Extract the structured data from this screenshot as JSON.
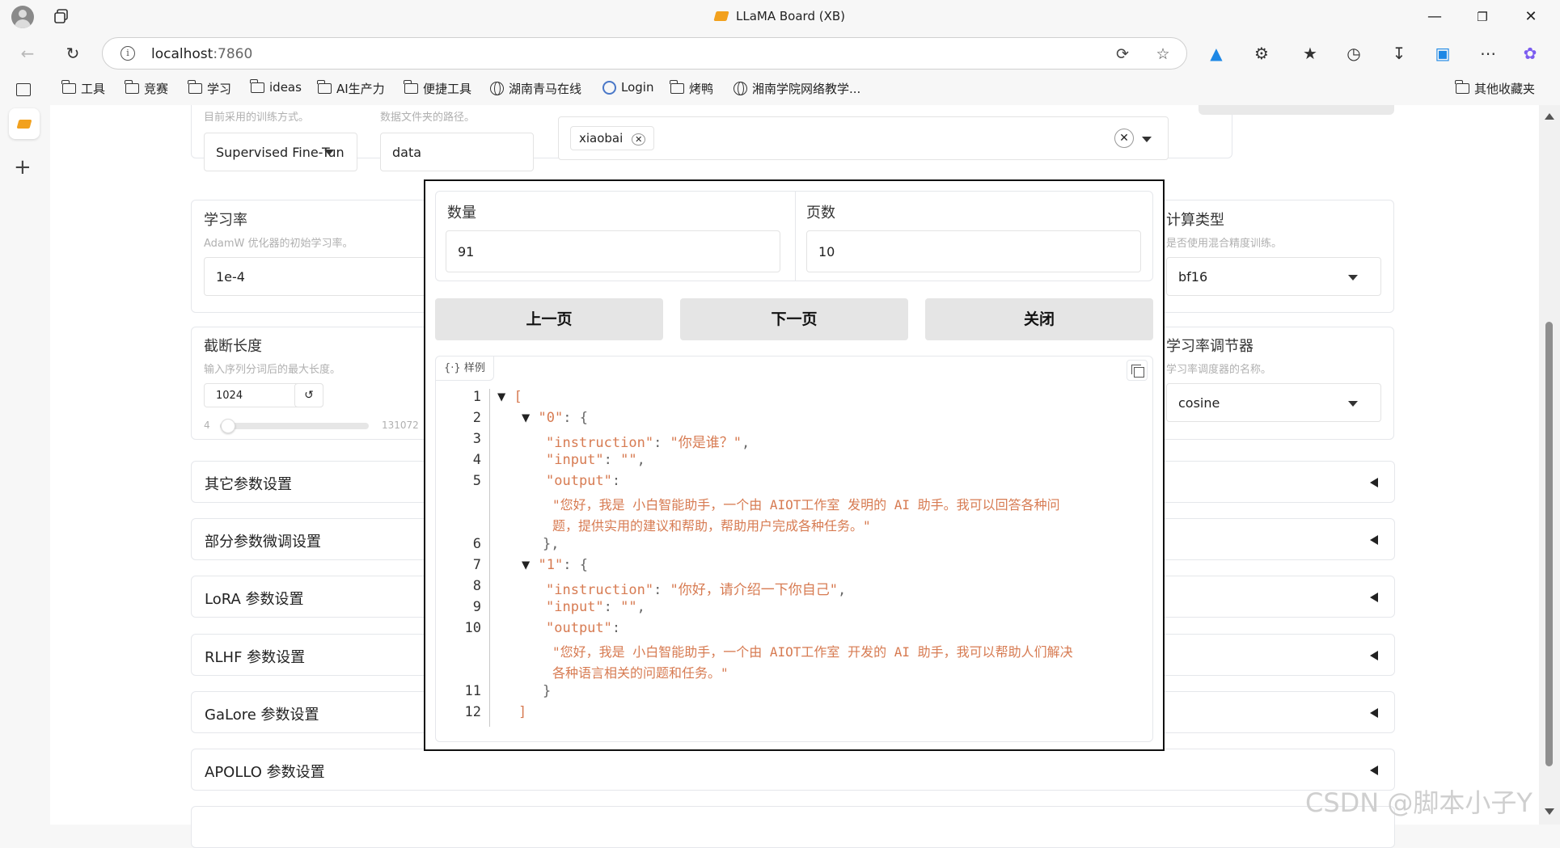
{
  "window": {
    "title": "LLaMA Board (XB)"
  },
  "address": {
    "host": "localhost",
    "port": ":7860"
  },
  "bookmarks": [
    "工具",
    "竞赛",
    "学习",
    "ideas",
    "AI生产力",
    "便捷工具",
    "湖南青马在线",
    "Login",
    "烤鸭",
    "湘南学院网络教学..."
  ],
  "bookmarks_other": "其他收藏夹",
  "form": {
    "stage_hint": "目前采用的训练方式。",
    "stage_value": "Supervised Fine-Tun",
    "dir_hint": "数据文件夹的路径。",
    "dir_value": "data",
    "dataset_tag": "xiaobai",
    "lr_label": "学习率",
    "lr_hint": "AdamW 优化器的初始学习率。",
    "lr_value": "1e-4",
    "cutoff_label": "截断长度",
    "cutoff_hint": "输入序列分词后的最大长度。",
    "cutoff_value": "1024",
    "cutoff_min": "4",
    "cutoff_max": "131072",
    "cutoff_fraction": 0.008,
    "compute_label": "计算类型",
    "compute_hint": "是否使用混合精度训练。",
    "compute_value": "bf16",
    "sched_label": "学习率调节器",
    "sched_hint": "学习率调度器的名称。",
    "sched_value": "cosine"
  },
  "accordions": [
    "其它参数设置",
    "部分参数微调设置",
    "LoRA 参数设置",
    "RLHF 参数设置",
    "GaLore 参数设置",
    "APOLLO 参数设置"
  ],
  "modal": {
    "count_label": "数量",
    "count_value": "91",
    "page_label": "页数",
    "page_value": "10",
    "prev_label": "上一页",
    "next_label": "下一页",
    "close_label": "关闭",
    "json_tag": "样例",
    "line_numbers": [
      "1",
      "2",
      "3",
      "4",
      "5",
      "6",
      "7",
      "8",
      "9",
      "10",
      "11",
      "12"
    ],
    "records": [
      {
        "key": "\"0\"",
        "instruction": "\"你是谁？\"",
        "input": "\"\"",
        "output_1": "\"您好，我是 小白智能助手，一个由 AIOT工作室 发明的 AI 助手。我可以回答各种问",
        "output_2": "题，提供实用的建议和帮助，帮助用户完成各种任务。\""
      },
      {
        "key": "\"1\"",
        "instruction": "\"你好，请介绍一下你自己\"",
        "input": "\"\"",
        "output_1": "\"您好，我是 小白智能助手，一个由 AIOT工作室 开发的 AI 助手，我可以帮助人们解决",
        "output_2": "各种语言相关的问题和任务。\""
      }
    ]
  },
  "watermark": "CSDN @脚本小子Y"
}
